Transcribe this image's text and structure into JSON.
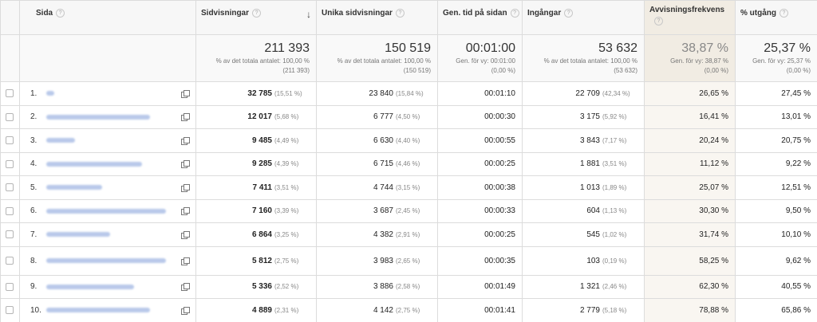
{
  "headers": {
    "page": "Sida",
    "pageviews": "Sidvisningar",
    "unique": "Unika sidvisningar",
    "time": "Gen. tid på sidan",
    "entrances": "Ingångar",
    "bounce": "Avvisningsfrekvens",
    "exit": "% utgång",
    "help": "?",
    "sort_arrow": "↓"
  },
  "totals": {
    "pageviews": {
      "value": "211 393",
      "sub1": "% av det totala antalet: 100,00 %",
      "sub2": "(211 393)"
    },
    "unique": {
      "value": "150 519",
      "sub1": "% av det totala antalet: 100,00 %",
      "sub2": "(150 519)"
    },
    "time": {
      "value": "00:01:00",
      "sub1": "Gen. för vy: 00:01:00",
      "sub2": "(0,00 %)"
    },
    "entrances": {
      "value": "53 632",
      "sub1": "% av det totala antalet: 100,00 %",
      "sub2": "(53 632)"
    },
    "bounce": {
      "value": "38,87 %",
      "sub1": "Gen. för vy: 38,87 %",
      "sub2": "(0,00 %)"
    },
    "exit": {
      "value": "25,37 %",
      "sub1": "Gen. för vy: 25,37 %",
      "sub2": "(0,00 %)"
    }
  },
  "rows": [
    {
      "rank": "1.",
      "pageviews": "32 785",
      "pv_pct": "(15,51 %)",
      "unique": "23 840",
      "u_pct": "(15,84 %)",
      "time": "00:01:10",
      "entrances": "22 709",
      "e_pct": "(42,34 %)",
      "bounce": "26,65 %",
      "exit": "27,45 %"
    },
    {
      "rank": "2.",
      "pageviews": "12 017",
      "pv_pct": "(5,68 %)",
      "unique": "6 777",
      "u_pct": "(4,50 %)",
      "time": "00:00:30",
      "entrances": "3 175",
      "e_pct": "(5,92 %)",
      "bounce": "16,41 %",
      "exit": "13,01 %"
    },
    {
      "rank": "3.",
      "pageviews": "9 485",
      "pv_pct": "(4,49 %)",
      "unique": "6 630",
      "u_pct": "(4,40 %)",
      "time": "00:00:55",
      "entrances": "3 843",
      "e_pct": "(7,17 %)",
      "bounce": "20,24 %",
      "exit": "20,75 %"
    },
    {
      "rank": "4.",
      "pageviews": "9 285",
      "pv_pct": "(4,39 %)",
      "unique": "6 715",
      "u_pct": "(4,46 %)",
      "time": "00:00:25",
      "entrances": "1 881",
      "e_pct": "(3,51 %)",
      "bounce": "11,12 %",
      "exit": "9,22 %"
    },
    {
      "rank": "5.",
      "pageviews": "7 411",
      "pv_pct": "(3,51 %)",
      "unique": "4 744",
      "u_pct": "(3,15 %)",
      "time": "00:00:38",
      "entrances": "1 013",
      "e_pct": "(1,89 %)",
      "bounce": "25,07 %",
      "exit": "12,51 %"
    },
    {
      "rank": "6.",
      "pageviews": "7 160",
      "pv_pct": "(3,39 %)",
      "unique": "3 687",
      "u_pct": "(2,45 %)",
      "time": "00:00:33",
      "entrances": "604",
      "e_pct": "(1,13 %)",
      "bounce": "30,30 %",
      "exit": "9,50 %"
    },
    {
      "rank": "7.",
      "pageviews": "6 864",
      "pv_pct": "(3,25 %)",
      "unique": "4 382",
      "u_pct": "(2,91 %)",
      "time": "00:00:25",
      "entrances": "545",
      "e_pct": "(1,02 %)",
      "bounce": "31,74 %",
      "exit": "10,10 %"
    },
    {
      "rank": "8.",
      "pageviews": "5 812",
      "pv_pct": "(2,75 %)",
      "unique": "3 983",
      "u_pct": "(2,65 %)",
      "time": "00:00:35",
      "entrances": "103",
      "e_pct": "(0,19 %)",
      "bounce": "58,25 %",
      "exit": "9,62 %"
    },
    {
      "rank": "9.",
      "pageviews": "5 336",
      "pv_pct": "(2,52 %)",
      "unique": "3 886",
      "u_pct": "(2,58 %)",
      "time": "00:01:49",
      "entrances": "1 321",
      "e_pct": "(2,46 %)",
      "bounce": "62,30 %",
      "exit": "40,55 %"
    },
    {
      "rank": "10.",
      "pageviews": "4 889",
      "pv_pct": "(2,31 %)",
      "unique": "4 142",
      "u_pct": "(2,75 %)",
      "time": "00:01:41",
      "entrances": "2 779",
      "e_pct": "(5,18 %)",
      "bounce": "78,88 %",
      "exit": "65,86 %"
    }
  ]
}
